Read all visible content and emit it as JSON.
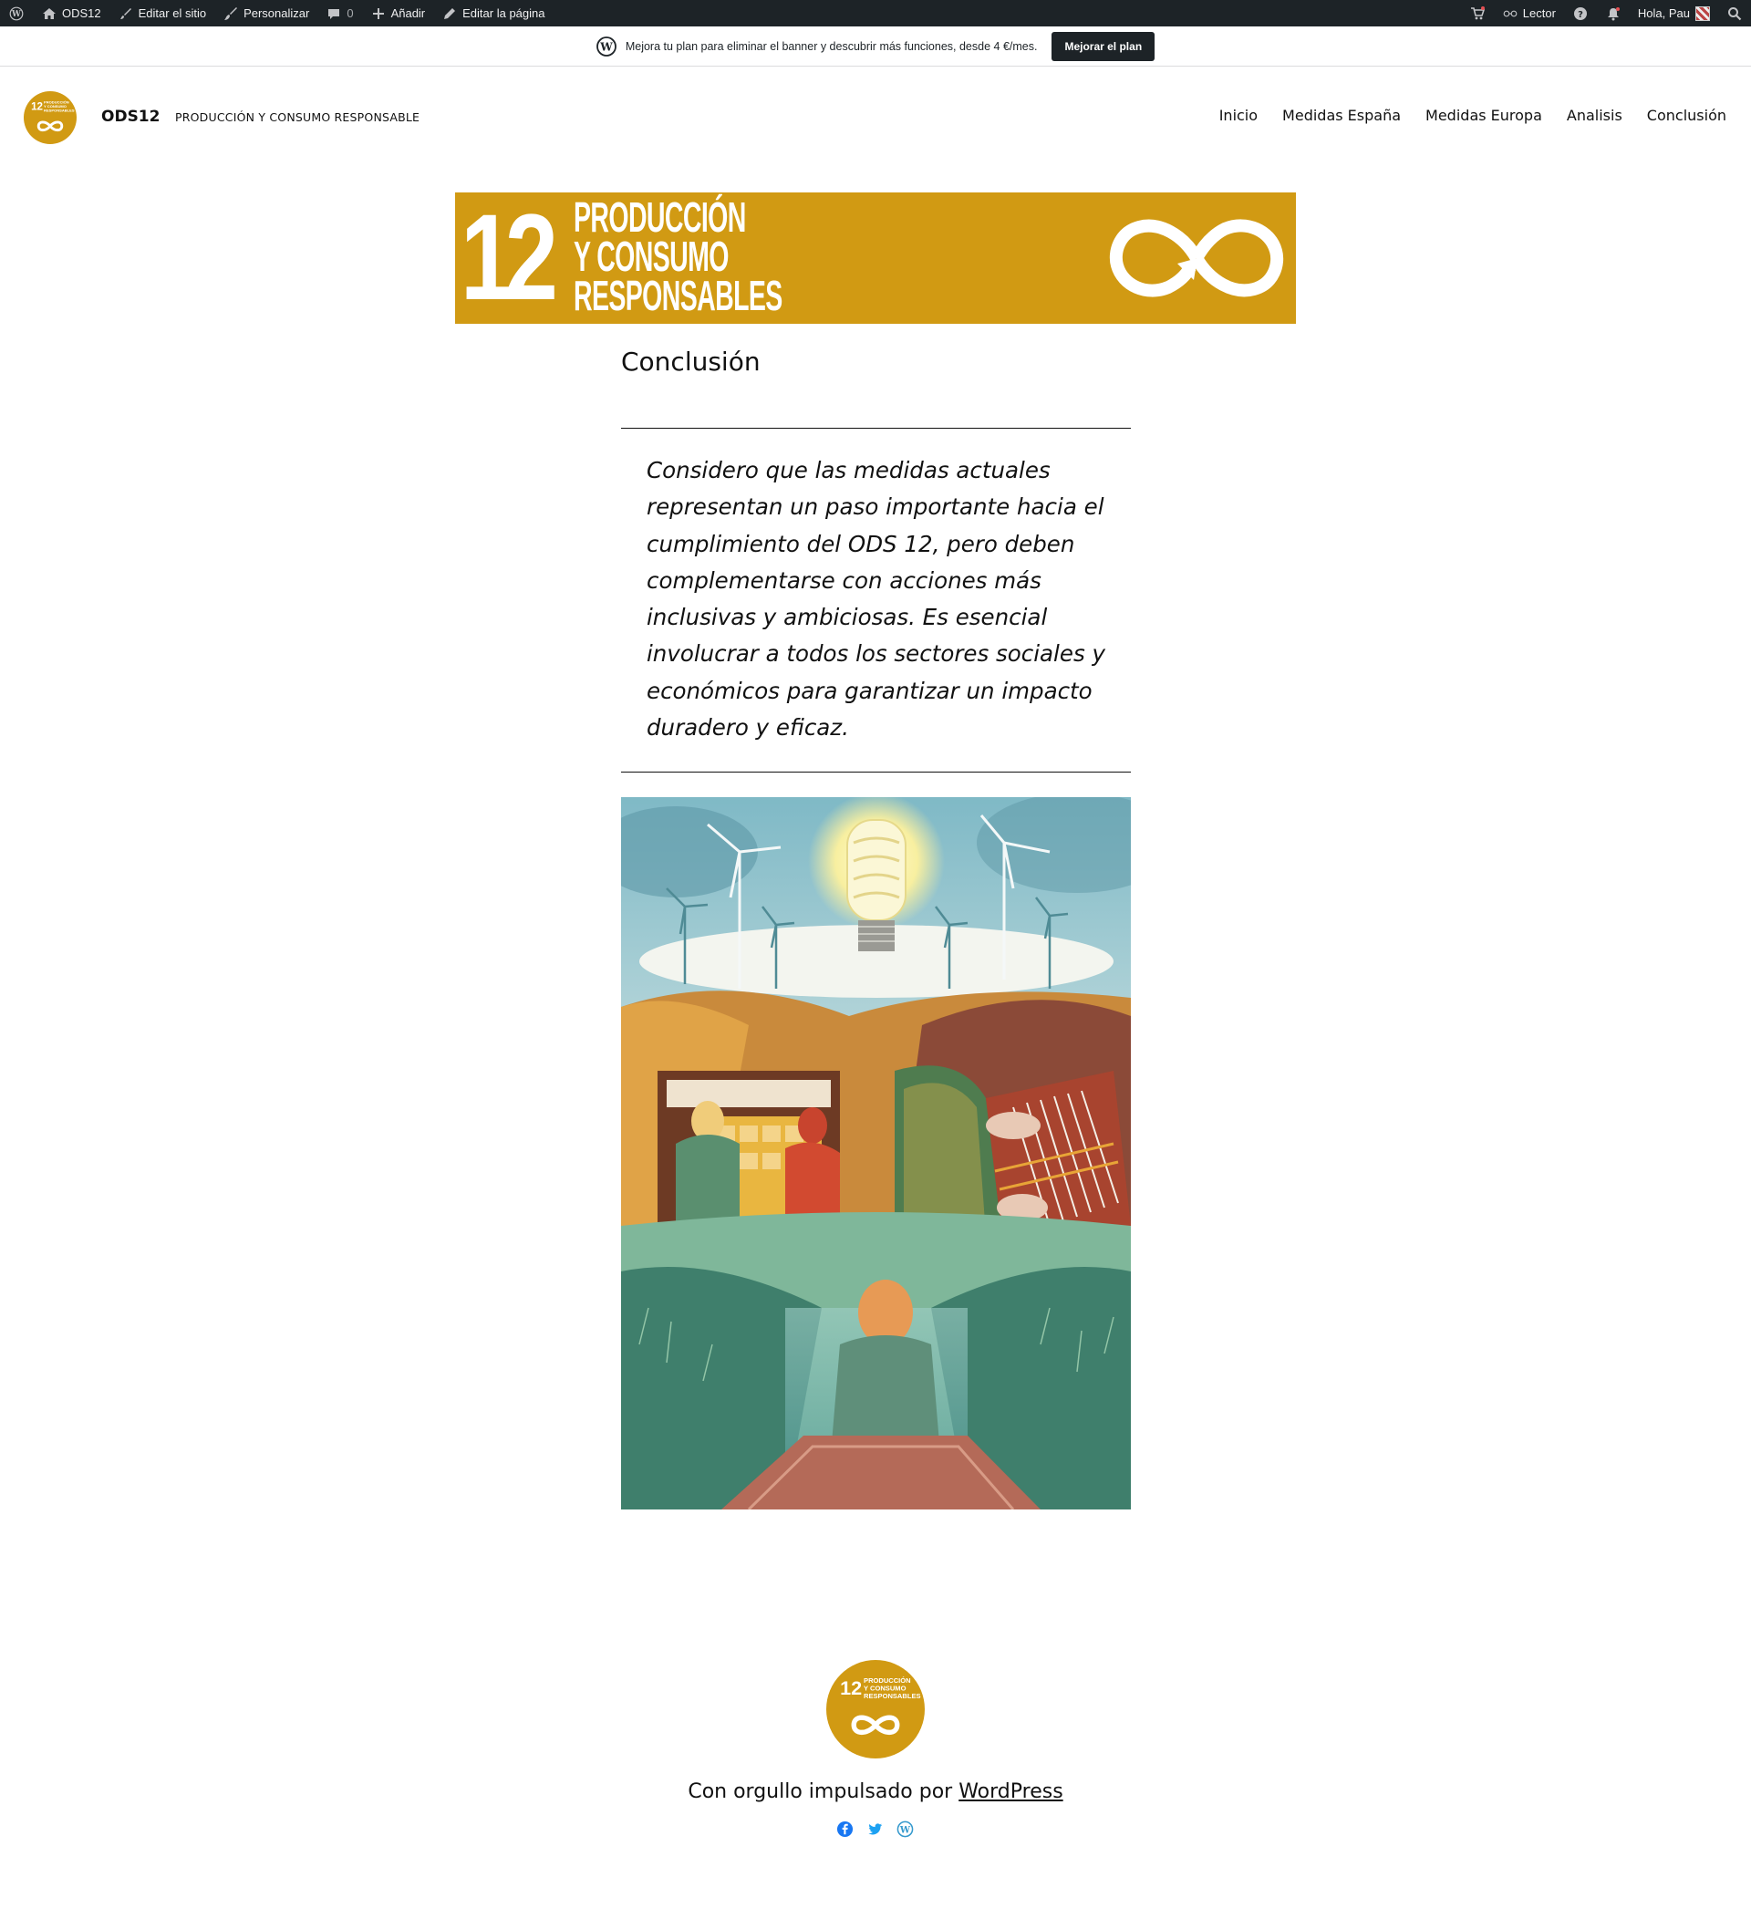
{
  "admin_bar": {
    "site_name": "ODS12",
    "edit_site": "Editar el sitio",
    "customize": "Personalizar",
    "comments_count": "0",
    "add_new": "Añadir",
    "edit_page": "Editar la página",
    "reader": "Lector",
    "greeting": "Hola, Pau"
  },
  "banner": {
    "text": "Mejora tu plan para eliminar el banner y descubrir más funciones, desde 4 €/mes.",
    "button": "Mejorar el plan"
  },
  "header": {
    "site_title": "ODS12",
    "tagline": "PRODUCCIÓN Y CONSUMO RESPONSABLE",
    "nav": [
      "Inicio",
      "Medidas España",
      "Medidas Europa",
      "Analisis",
      "Conclusión"
    ]
  },
  "hero": {
    "number": "12",
    "lines": [
      "PRODUCCIÓN",
      "Y CONSUMO",
      "RESPONSABLES"
    ]
  },
  "logo": {
    "number": "12",
    "lines": [
      "PRODUCCIÓN",
      "Y CONSUMO",
      "RESPONSABLES"
    ]
  },
  "content": {
    "title": "Conclusión",
    "quote": " Considero que las medidas actuales representan un paso importante hacia el cumplimiento del ODS 12, pero deben complementarse con acciones más inclusivas y ambiciosas. Es esencial involucrar a todos los sectores sociales y económicos para garantizar un impacto duradero y eficaz."
  },
  "footer": {
    "powered_prefix": "Con orgullo impulsado por ",
    "powered_link": "WordPress",
    "social_icons": [
      "facebook-icon",
      "twitter-icon",
      "wordpress-icon"
    ]
  },
  "colors": {
    "brand": "#d19a13",
    "adminbar": "#1d2327",
    "facebook": "#1877f2",
    "twitter": "#1da1f2",
    "wordpress": "#3499cd"
  }
}
